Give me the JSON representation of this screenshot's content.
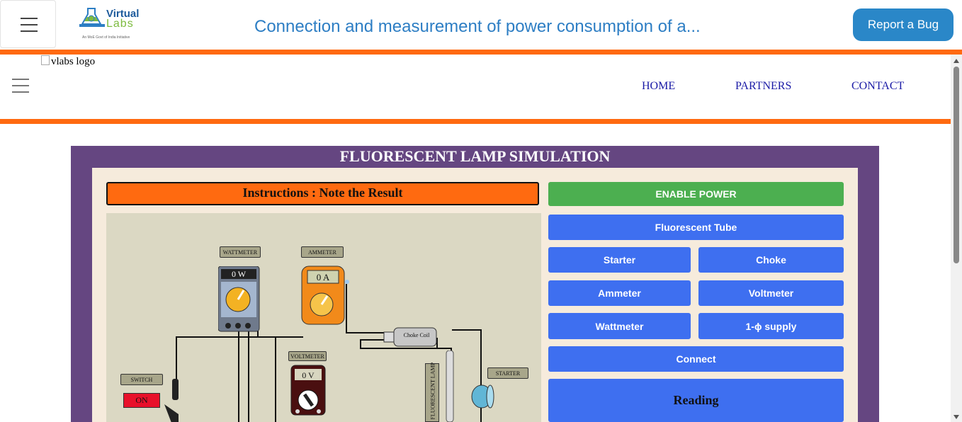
{
  "header": {
    "brand_line1": "Virtual",
    "brand_line2": "Labs",
    "brand_tagline": "An MoE Govt of India Initiative",
    "title": "Connection and measurement of power consumption of a...",
    "report_bug": "Report a Bug"
  },
  "site": {
    "logo_alt": "vlabs logo",
    "nav": [
      "HOME",
      "PARTNERS",
      "CONTACT"
    ]
  },
  "simulation": {
    "title": "FLUORESCENT LAMP SIMULATION",
    "instruction": "Instructions : Note the Result",
    "buttons": {
      "enable_power": "ENABLE POWER",
      "fluorescent_tube": "Fluorescent Tube",
      "starter": "Starter",
      "choke": "Choke",
      "ammeter": "Ammeter",
      "voltmeter": "Voltmeter",
      "wattmeter": "Wattmeter",
      "supply": "1-ϕ supply",
      "connect": "Connect",
      "reading": "Reading"
    },
    "canvas": {
      "wattmeter_label": "WATTMETER",
      "wattmeter_value": "0 W",
      "ammeter_label": "AMMETER",
      "ammeter_value": "0 A",
      "voltmeter_label": "VOLTMETER",
      "voltmeter_value": "0 V",
      "choke_label": "Choke Coil",
      "switch_label": "SWITCH",
      "switch_state": "ON",
      "starter_label": "STARTER",
      "lamp_label": "FLUORESCENT LAMP"
    }
  },
  "colors": {
    "accent_orange": "#ff6a10",
    "frame_purple": "#654681",
    "button_blue": "#3e6ff0",
    "button_green": "#4caf50",
    "bug_button": "#2a87c8",
    "title_blue": "#2d7ec4"
  },
  "icons": [
    "hamburger-menu-icon",
    "virtual-labs-logo",
    "broken-image-icon",
    "scroll-up-arrow-icon",
    "scroll-down-arrow-icon"
  ]
}
